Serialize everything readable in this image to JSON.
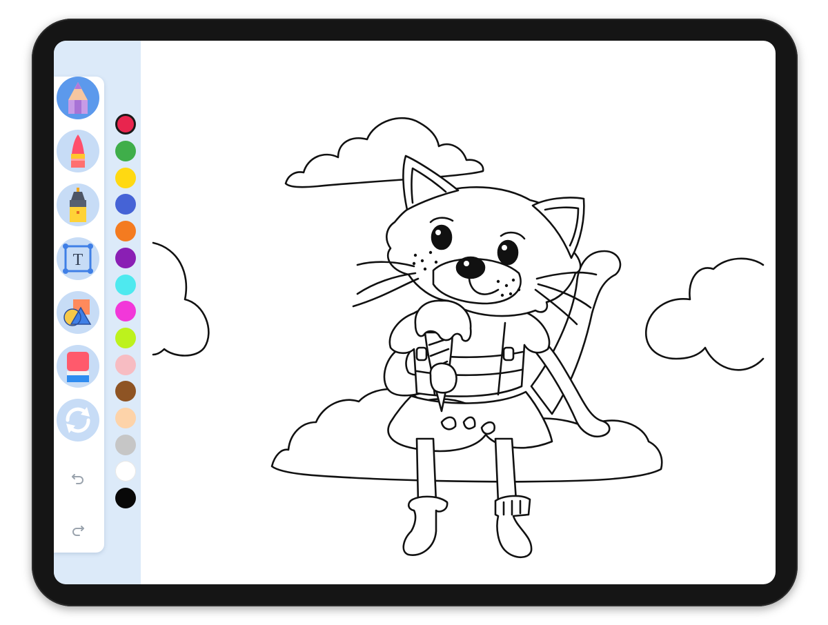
{
  "app": {
    "accent_color": "#5c99ec",
    "tool_bg_color": "#c7dcf6",
    "panel_band_color": "#dceaf9"
  },
  "toolbar": {
    "tools": [
      {
        "name": "pencil",
        "icon": "pencil-icon",
        "active": true
      },
      {
        "name": "crayon",
        "icon": "crayon-icon",
        "active": false
      },
      {
        "name": "marker",
        "icon": "marker-icon",
        "active": false
      },
      {
        "name": "text",
        "icon": "text-icon",
        "text_glyph": "T",
        "active": false
      },
      {
        "name": "shapes",
        "icon": "shapes-icon",
        "active": false
      },
      {
        "name": "eraser",
        "icon": "eraser-icon",
        "active": false
      },
      {
        "name": "reset",
        "icon": "refresh-icon",
        "active": false
      }
    ],
    "history": [
      {
        "name": "undo",
        "icon": "undo-icon"
      },
      {
        "name": "redo",
        "icon": "redo-icon"
      }
    ]
  },
  "palette": {
    "selected_index": 0,
    "colors": [
      "#e8254e",
      "#3fae4a",
      "#ffd912",
      "#4563d6",
      "#f47b20",
      "#8a1fb4",
      "#4ee9ef",
      "#f238d9",
      "#bdf21d",
      "#f7bcc2",
      "#8e5424",
      "#fdd3a9",
      "#c6c6c6",
      "#ffffff",
      "#080808"
    ]
  },
  "canvas": {
    "drawing": "cat-with-ice-cream-on-cloud",
    "line_color": "#111111",
    "fill_color": "#ffffff"
  }
}
